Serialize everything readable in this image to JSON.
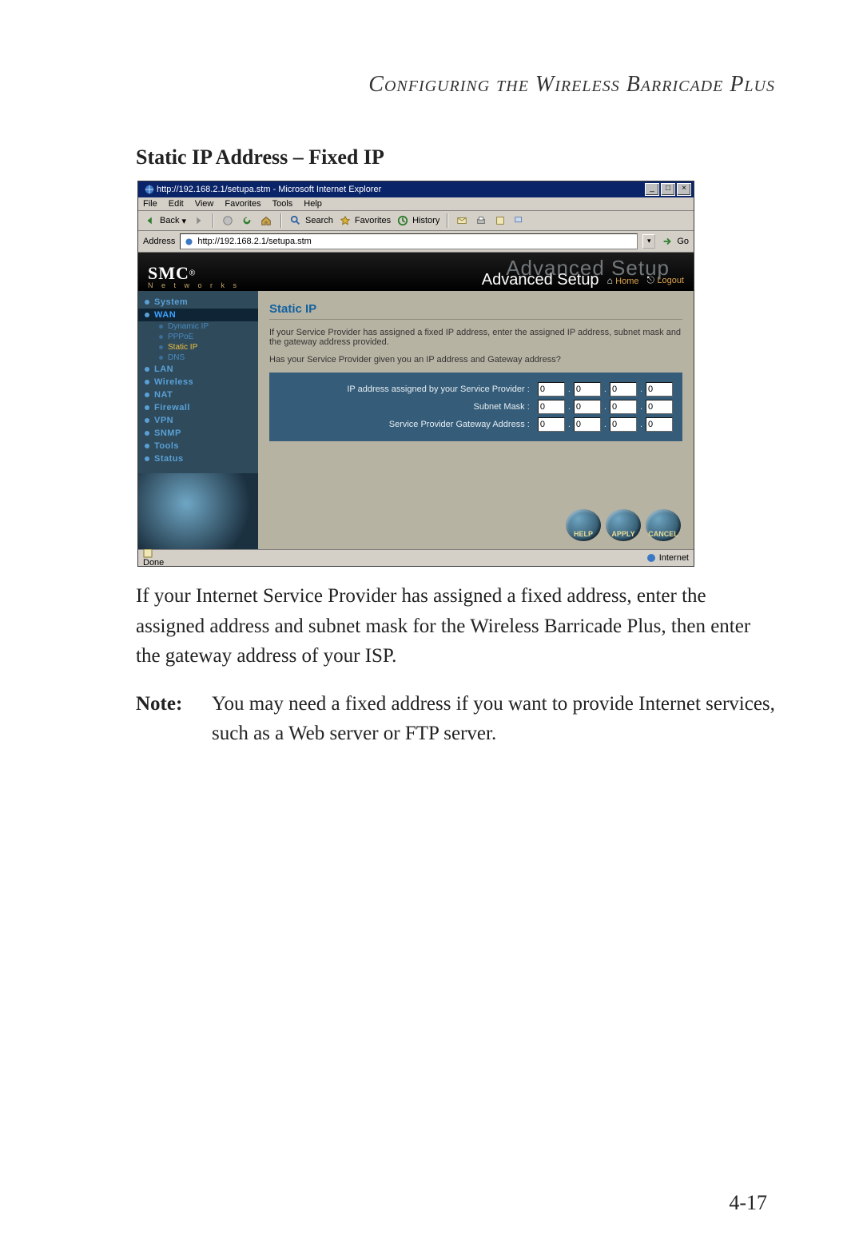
{
  "running_head": "Configuring the Wireless Barricade Plus",
  "section_title": "Static IP Address – Fixed IP",
  "browser": {
    "title": "http://192.168.2.1/setupa.stm - Microsoft Internet Explorer",
    "menu": [
      "File",
      "Edit",
      "View",
      "Favorites",
      "Tools",
      "Help"
    ],
    "toolbar": {
      "back": "Back",
      "search": "Search",
      "favorites": "Favorites",
      "history": "History"
    },
    "address_label": "Address",
    "address_value": "http://192.168.2.1/setupa.stm",
    "go": "Go",
    "status_left": "Done",
    "status_zone": "Internet"
  },
  "banner": {
    "logo": "SMC",
    "logo_sub": "N e t w o r k s",
    "ghost": "Advanced Setup",
    "title": "Advanced Setup",
    "home": "Home",
    "logout": "Logout"
  },
  "sidebar": {
    "items": [
      {
        "label": "System",
        "type": "grp"
      },
      {
        "label": "WAN",
        "type": "grp",
        "on": true
      },
      {
        "label": "Dynamic IP",
        "type": "sub"
      },
      {
        "label": "PPPoE",
        "type": "sub"
      },
      {
        "label": "Static IP",
        "type": "sub",
        "on": true
      },
      {
        "label": "DNS",
        "type": "sub"
      },
      {
        "label": "LAN",
        "type": "grp"
      },
      {
        "label": "Wireless",
        "type": "grp"
      },
      {
        "label": "NAT",
        "type": "grp"
      },
      {
        "label": "Firewall",
        "type": "grp"
      },
      {
        "label": "VPN",
        "type": "grp"
      },
      {
        "label": "SNMP",
        "type": "grp"
      },
      {
        "label": "Tools",
        "type": "grp"
      },
      {
        "label": "Status",
        "type": "grp"
      }
    ]
  },
  "content": {
    "heading": "Static IP",
    "p1": "If your Service Provider has assigned a fixed IP address, enter the assigned IP address, subnet mask and the gateway address provided.",
    "p2": "Has your Service Provider given you an IP address and Gateway address?",
    "rows": [
      {
        "label": "IP address assigned by your Service Provider :",
        "v": [
          "0",
          "0",
          "0",
          "0"
        ]
      },
      {
        "label": "Subnet Mask :",
        "v": [
          "0",
          "0",
          "0",
          "0"
        ]
      },
      {
        "label": "Service Provider Gateway Address :",
        "v": [
          "0",
          "0",
          "0",
          "0"
        ]
      }
    ],
    "buttons": {
      "help": "HELP",
      "apply": "APPLY",
      "cancel": "CANCEL"
    }
  },
  "copy": {
    "para": "If your Internet Service Provider has assigned a fixed address, enter the assigned address and subnet mask for the Wireless Barricade Plus, then enter the gateway address of your ISP.",
    "note_label": "Note:",
    "note_body": "You may need a fixed address if you want to provide Internet services, such as a Web server or FTP server."
  },
  "page_number": "4-17"
}
